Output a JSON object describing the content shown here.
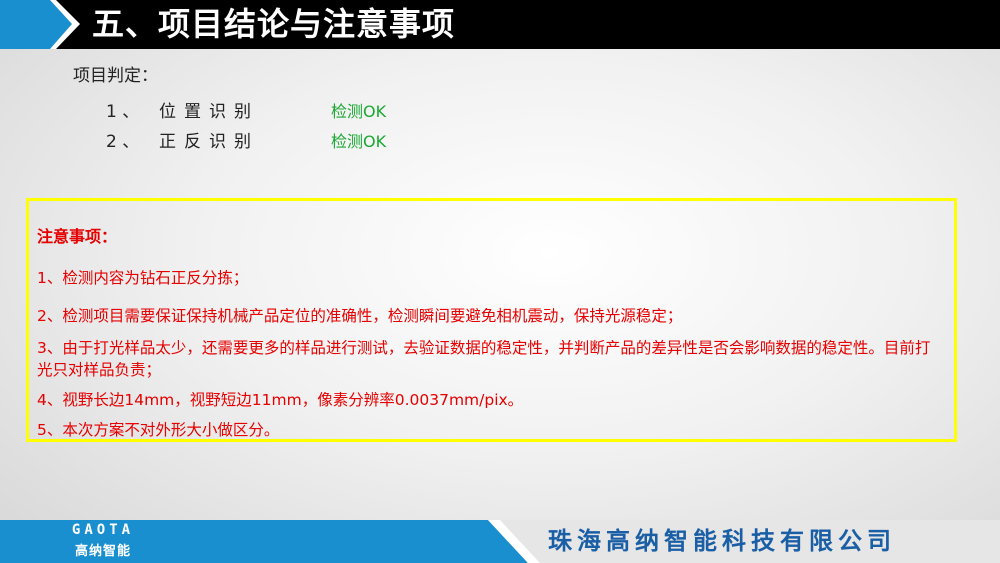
{
  "header": {
    "title": "五、项目结论与注意事项"
  },
  "judgement": {
    "heading": "项目判定：",
    "rows": [
      {
        "num": "1 、",
        "item": "位置识别",
        "result": "检测OK"
      },
      {
        "num": "2 、",
        "item": "正反识别",
        "result": "检测OK"
      }
    ]
  },
  "notice": {
    "title": "注意事项：",
    "lines": [
      "1、检测内容为钻石正反分拣；",
      "2、检测项目需要保证保持机械产品定位的准确性，检测瞬间要避免相机震动，保持光源稳定；",
      "3、由于打光样品太少，还需要更多的样品进行测试，去验证数据的稳定性，并判断产品的差异性是否会影响数据的稳定性。目前打光只对样品负责；",
      "4、视野长边14mm，视野短边11mm，像素分辨率0.0037mm/pix。",
      "5、本次方案不对外形大小做区分。"
    ]
  },
  "footer": {
    "logo_text": "GAOTA",
    "logo_sub": "高纳智能",
    "company": "珠海高纳智能科技有限公司"
  },
  "colors": {
    "header_bg": "#000000",
    "accent_blue": "#1a8fd0",
    "notice_border": "#ffff00",
    "notice_text": "#e60000",
    "ok_text": "#1aa832",
    "company_text": "#1a5fa6"
  }
}
